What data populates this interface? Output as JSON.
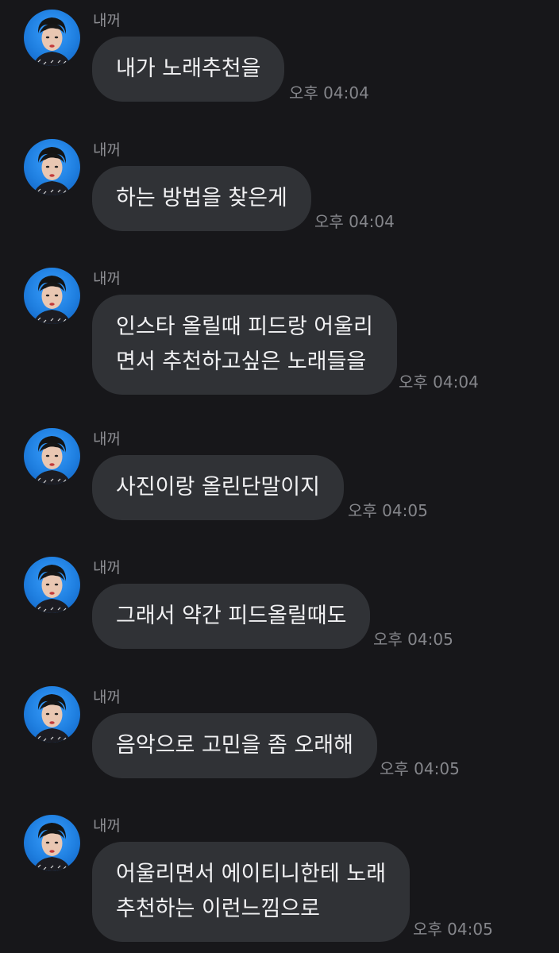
{
  "messages": [
    {
      "sender": "내꺼",
      "text": "내가 노래추천을",
      "time": "오후 04:04"
    },
    {
      "sender": "내꺼",
      "text": "하는 방법을 찾은게",
      "time": "오후 04:04"
    },
    {
      "sender": "내꺼",
      "text": "인스타 올릴때 피드랑 어울리\n면서 추천하고싶은 노래들을",
      "time": "오후 04:04"
    },
    {
      "sender": "내꺼",
      "text": "사진이랑 올린단말이지",
      "time": "오후 04:05"
    },
    {
      "sender": "내꺼",
      "text": "그래서 약간 피드올릴때도",
      "time": "오후 04:05"
    },
    {
      "sender": "내꺼",
      "text": "음악으로 고민을 좀 오래해",
      "time": "오후 04:05"
    },
    {
      "sender": "내꺼",
      "text": "어울리면서 에이티니한테 노래\n추천하는 이런느낌으로",
      "time": "오후 04:05"
    }
  ],
  "colors": {
    "background": "#17171a",
    "bubble": "#303236",
    "bubble_text": "#f1f1f3",
    "sender_text": "#8d8e93",
    "time_text": "#85868b",
    "avatar_bg": "#1f7fe0"
  },
  "icons": {
    "avatar": "profile-photo"
  }
}
